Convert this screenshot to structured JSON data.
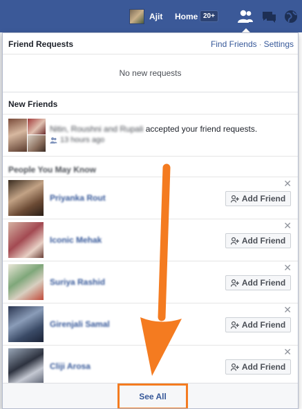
{
  "topbar": {
    "user_name": "Ajit",
    "home_label": "Home",
    "home_badge": "20+",
    "icons": [
      "friend-requests-icon",
      "messages-icon",
      "notifications-globe-icon"
    ]
  },
  "friend_requests": {
    "title": "Friend Requests",
    "find_friends": "Find Friends",
    "separator": "·",
    "settings": "Settings",
    "empty_text": "No new requests"
  },
  "new_friends": {
    "title": "New Friends",
    "names_blurred": "Nitin, Roushni and Rupali",
    "message": " accepted your friend requests.",
    "time": "13 hours ago"
  },
  "pymk": {
    "title": "People You May Know",
    "people": [
      {
        "name": "Priyanka Rout",
        "button": "Add Friend"
      },
      {
        "name": "Iconic Mehak",
        "button": "Add Friend"
      },
      {
        "name": "Suriya Rashid",
        "button": "Add Friend"
      },
      {
        "name": "Girenjali Samal",
        "button": "Add Friend"
      },
      {
        "name": "Cliji Arosa",
        "button": "Add Friend"
      }
    ]
  },
  "footer": {
    "see_all": "See All"
  },
  "annotation": {
    "color": "#f47b20"
  },
  "colors": {
    "brand": "#3b5998",
    "link": "#365899"
  }
}
